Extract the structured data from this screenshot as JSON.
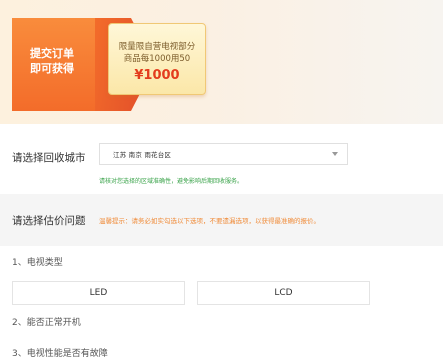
{
  "promo": {
    "badge_line1": "提交订单",
    "badge_line2": "即可获得",
    "coupon_line1": "限量限自营电视部分",
    "coupon_line2": "商品每1000用50",
    "coupon_amount": "¥1000"
  },
  "city": {
    "label": "请选择回收城市",
    "selected_value": "江苏 南京 雨花台区",
    "hint": "请核对您选择的区域准确性，避免影响后期回收服务。"
  },
  "questions_section": {
    "label": "请选择估价问题",
    "tip": "温馨提示：请务必如实勾选以下选项，不要遗漏选项，以获得最准确的报价。"
  },
  "questions": [
    {
      "text": "1、电视类型",
      "options": [
        "LED",
        "LCD"
      ]
    },
    {
      "text": "2、能否正常开机"
    },
    {
      "text": "3、电视性能是否有故障"
    }
  ],
  "colors": {
    "accent_orange": "#f36c2a",
    "coupon_amount": "#e33c1e",
    "hint_green": "#3aa34a",
    "tip_orange": "#f08c3a"
  }
}
